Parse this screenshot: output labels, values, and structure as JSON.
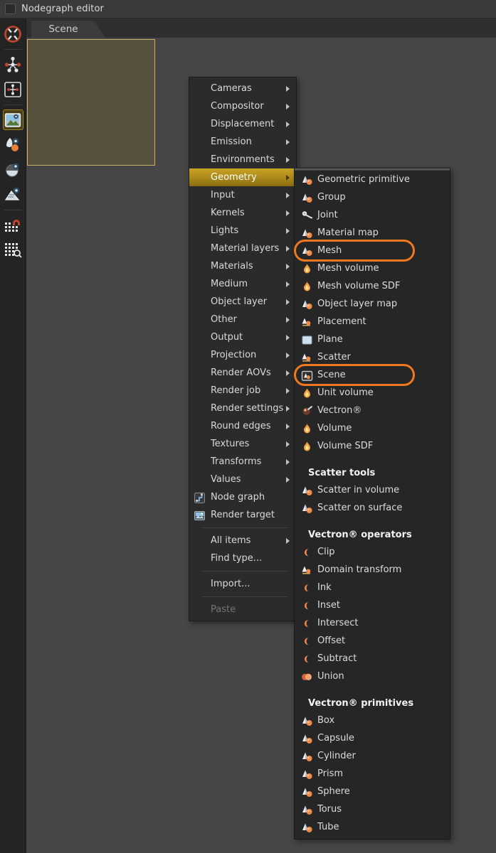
{
  "window": {
    "title": "Nodegraph editor",
    "swatch_icon": "window-swatch-icon"
  },
  "colors": {
    "accent_highlight": "#b08d1c",
    "focus_ring": "#f07820",
    "selection_border": "#c9b062",
    "menu_bg": "#2b2b2b",
    "submenu_bg": "#262626",
    "canvas_bg": "#464646",
    "rail_bg": "#242424"
  },
  "rail": {
    "items": [
      {
        "name": "octane-logo-icon",
        "active": false
      },
      {
        "name": "nodegraph-icon",
        "active": false
      },
      {
        "name": "nodegraph-alt-icon",
        "active": false
      },
      {
        "name": "render-viewport-icon",
        "active": true
      },
      {
        "name": "material-preview-icon",
        "active": false
      },
      {
        "name": "sphere-preview-icon",
        "active": false
      },
      {
        "name": "geometry-preview-icon",
        "active": false
      },
      {
        "name": "magnet-grid-icon",
        "active": false
      },
      {
        "name": "grid-icon",
        "active": false
      }
    ]
  },
  "canvas": {
    "tab_label": "Scene",
    "selected_node_name": "scene-node-selection"
  },
  "context_menu": {
    "items": [
      {
        "label": "Cameras",
        "type": "submenu"
      },
      {
        "label": "Compositor",
        "type": "submenu"
      },
      {
        "label": "Displacement",
        "type": "submenu"
      },
      {
        "label": "Emission",
        "type": "submenu"
      },
      {
        "label": "Environments",
        "type": "submenu"
      },
      {
        "label": "Geometry",
        "type": "submenu",
        "highlighted": true
      },
      {
        "label": "Input",
        "type": "submenu"
      },
      {
        "label": "Kernels",
        "type": "submenu"
      },
      {
        "label": "Lights",
        "type": "submenu"
      },
      {
        "label": "Material layers",
        "type": "submenu"
      },
      {
        "label": "Materials",
        "type": "submenu"
      },
      {
        "label": "Medium",
        "type": "submenu"
      },
      {
        "label": "Object layer",
        "type": "submenu"
      },
      {
        "label": "Other",
        "type": "submenu"
      },
      {
        "label": "Output",
        "type": "submenu"
      },
      {
        "label": "Projection",
        "type": "submenu"
      },
      {
        "label": "Render AOVs",
        "type": "submenu"
      },
      {
        "label": "Render job",
        "type": "submenu"
      },
      {
        "label": "Render settings",
        "type": "submenu"
      },
      {
        "label": "Round edges",
        "type": "submenu"
      },
      {
        "label": "Textures",
        "type": "submenu"
      },
      {
        "label": "Transforms",
        "type": "submenu"
      },
      {
        "label": "Values",
        "type": "submenu"
      },
      {
        "label": "Node graph",
        "type": "item",
        "icon": "node-graph-icon"
      },
      {
        "label": "Render target",
        "type": "item",
        "icon": "render-target-icon"
      },
      {
        "type": "separator"
      },
      {
        "label": "All items",
        "type": "submenu"
      },
      {
        "label": "Find type...",
        "type": "item"
      },
      {
        "type": "separator"
      },
      {
        "label": "Import...",
        "type": "item"
      },
      {
        "type": "separator"
      },
      {
        "label": "Paste",
        "type": "item",
        "disabled": true
      }
    ]
  },
  "submenu": {
    "title": "Geometry",
    "items": [
      {
        "label": "Geometric primitive",
        "icon": "geometry-node-icon"
      },
      {
        "label": "Group",
        "icon": "geometry-node-icon"
      },
      {
        "label": "Joint",
        "icon": "joint-node-icon"
      },
      {
        "label": "Material map",
        "icon": "geometry-node-icon"
      },
      {
        "label": "Mesh",
        "icon": "geometry-node-icon",
        "ringed": true
      },
      {
        "label": "Mesh volume",
        "icon": "volume-node-icon"
      },
      {
        "label": "Mesh volume SDF",
        "icon": "volume-node-icon"
      },
      {
        "label": "Object layer map",
        "icon": "geometry-node-icon"
      },
      {
        "label": "Placement",
        "icon": "placement-node-icon"
      },
      {
        "label": "Plane",
        "icon": "plane-node-icon"
      },
      {
        "label": "Scatter",
        "icon": "placement-node-icon"
      },
      {
        "label": "Scene",
        "icon": "scene-node-icon",
        "ringed": true
      },
      {
        "label": "Unit volume",
        "icon": "volume-node-icon"
      },
      {
        "label": "Vectron®",
        "icon": "vectron-node-icon"
      },
      {
        "label": "Volume",
        "icon": "volume-node-icon"
      },
      {
        "label": "Volume SDF",
        "icon": "volume-node-icon"
      },
      {
        "type": "header",
        "label": "Scatter tools"
      },
      {
        "label": "Scatter in volume",
        "icon": "geometry-node-icon"
      },
      {
        "label": "Scatter on surface",
        "icon": "geometry-node-icon"
      },
      {
        "type": "header",
        "label": "Vectron® operators"
      },
      {
        "label": "Clip",
        "icon": "vectron-op-icon"
      },
      {
        "label": "Domain transform",
        "icon": "placement-node-icon"
      },
      {
        "label": "Ink",
        "icon": "vectron-op-icon"
      },
      {
        "label": "Inset",
        "icon": "vectron-op-icon"
      },
      {
        "label": "Intersect",
        "icon": "vectron-op-icon"
      },
      {
        "label": "Offset",
        "icon": "vectron-op-icon"
      },
      {
        "label": "Subtract",
        "icon": "vectron-op-icon"
      },
      {
        "label": "Union",
        "icon": "vectron-union-icon"
      },
      {
        "type": "header",
        "label": "Vectron® primitives"
      },
      {
        "label": "Box",
        "icon": "geometry-node-icon"
      },
      {
        "label": "Capsule",
        "icon": "geometry-node-icon"
      },
      {
        "label": "Cylinder",
        "icon": "geometry-node-icon"
      },
      {
        "label": "Prism",
        "icon": "geometry-node-icon"
      },
      {
        "label": "Sphere",
        "icon": "geometry-node-icon"
      },
      {
        "label": "Torus",
        "icon": "geometry-node-icon"
      },
      {
        "label": "Tube",
        "icon": "geometry-node-icon"
      }
    ]
  }
}
